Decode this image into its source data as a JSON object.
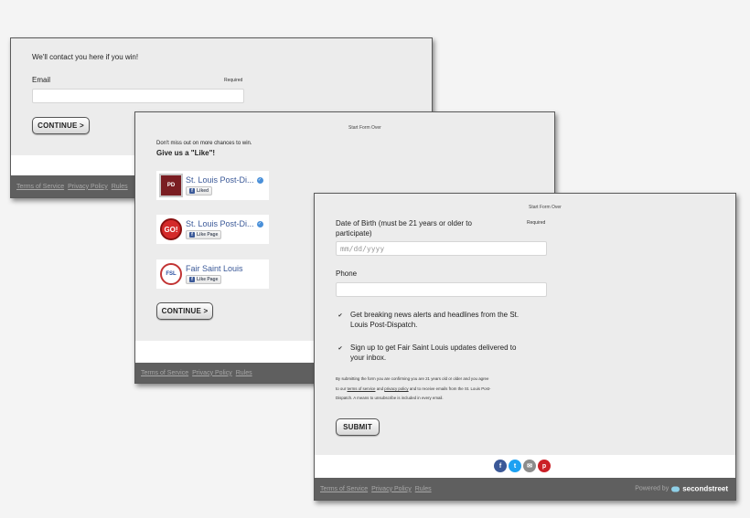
{
  "footer_links": [
    "Terms of Service",
    "Privacy Policy",
    "Rules"
  ],
  "step1": {
    "heading": "We'll contact you here if you win!",
    "email_label": "Email",
    "required_label": "Required",
    "email_value": "",
    "continue_label": "CONTINUE >"
  },
  "step2": {
    "start_over": "Start Form Over",
    "subtitle": "Don't miss out on more chances to win.",
    "heading": "Give us a \"Like\"!",
    "pages": [
      {
        "name": "St. Louis Post-Di...",
        "button": "Liked",
        "verified": true,
        "logo": "PD"
      },
      {
        "name": "St. Louis Post-Di...",
        "button": "Like Page",
        "verified": true,
        "logo": "GO!"
      },
      {
        "name": "Fair Saint Louis",
        "button": "Like Page",
        "verified": false,
        "logo": "FSL"
      }
    ],
    "continue_label": "CONTINUE >"
  },
  "step3": {
    "start_over": "Start Form Over",
    "dob_label_line1": "Date of Birth (must be 21 years or older to",
    "dob_label_line2": "participate)",
    "required_label": "Required",
    "dob_placeholder": "mm/dd/yyyy",
    "phone_label": "Phone",
    "phone_value": "",
    "checkbox1_line1": "Get breaking news alerts and headlines from the St.",
    "checkbox1_line2": "Louis Post-Dispatch.",
    "checkbox2_line1": "Sign up to get Fair Saint Louis updates delivered to",
    "checkbox2_line2": "your inbox.",
    "legal_line1": "By submitting the form you are confirming you are 21 years old or older and you agree",
    "legal_line2_pre": "to our",
    "legal_terms": "terms of service",
    "legal_and": "and",
    "legal_privacy": "privacy policy",
    "legal_line2_post": "and to receive emails from the St. Louis Post-",
    "legal_line3": "Dispatch. A means to unsubscribe is included in every email.",
    "submit_label": "SUBMIT",
    "powered_by": "Powered by",
    "brand": "secondstreet"
  },
  "social": [
    {
      "icon": "facebook-icon",
      "glyph": "f",
      "color": "#3b5998"
    },
    {
      "icon": "twitter-icon",
      "glyph": "t",
      "color": "#1da1f2"
    },
    {
      "icon": "email-icon",
      "glyph": "✉",
      "color": "#8c8c8c"
    },
    {
      "icon": "pinterest-icon",
      "glyph": "p",
      "color": "#cb2027"
    }
  ],
  "colors": {
    "card_bg": "#ececec",
    "footer_bg": "#5f5f5f",
    "facebook_blue": "#3b5998"
  }
}
